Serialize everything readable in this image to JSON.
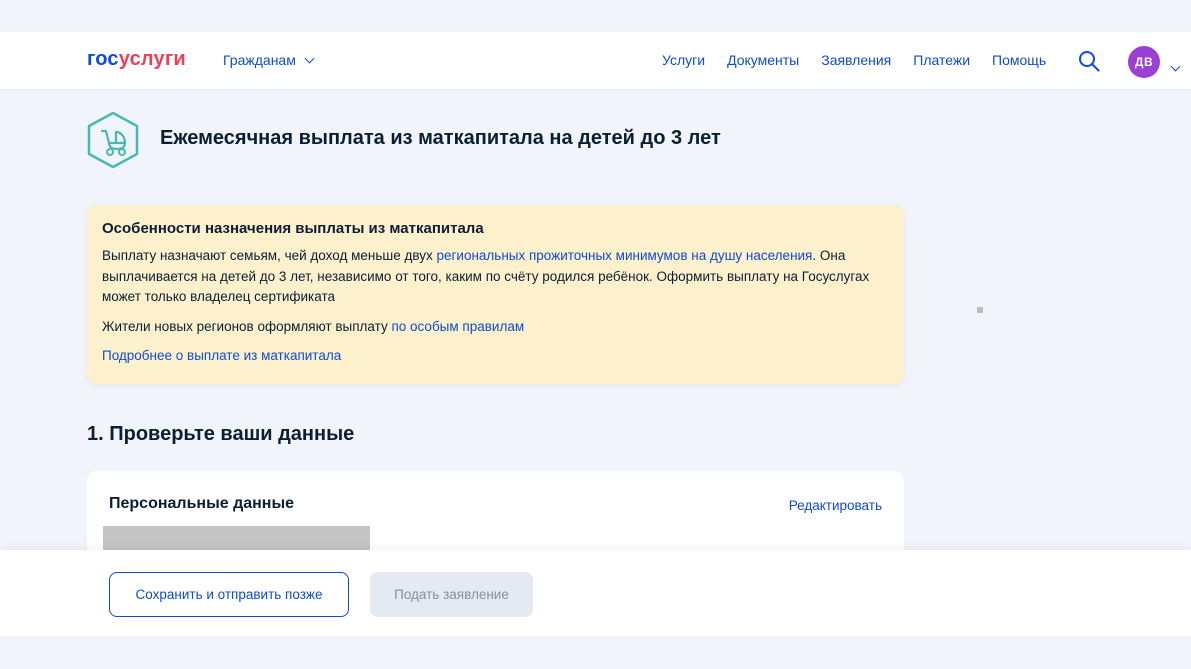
{
  "header": {
    "logo_part1": "гос",
    "logo_part2": "услуги",
    "audience": "Гражданам",
    "nav": [
      "Услуги",
      "Документы",
      "Заявления",
      "Платежи",
      "Помощь"
    ],
    "avatar_initials": "ДВ",
    "icons": {
      "search": "search-icon",
      "chevron": "chevron-down-icon"
    }
  },
  "page": {
    "title": "Ежемесячная выплата из маткапитала на детей до 3 лет",
    "title_icon": "stroller-icon"
  },
  "notice": {
    "heading": "Особенности назначения выплаты из маткапитала",
    "p1_before": "Выплату назначают семьям, чей доход меньше двух ",
    "p1_link": "региональных прожиточных минимумов на душу населения",
    "p1_after": ". Она выплачивается на детей до 3 лет, независимо от того, каким по счёту родился ребёнок. Оформить выплату на Госуслугах может только владелец сертификата",
    "p2_before": "Жители новых регионов оформляют выплату ",
    "p2_link": "по особым правилам",
    "p3_link": "Подробнее о выплате из маткапитала"
  },
  "step": {
    "title": "1. Проверьте ваши данные"
  },
  "personal_card": {
    "title": "Персональные данные",
    "edit_label": "Редактировать"
  },
  "footer": {
    "save_later": "Сохранить и отправить позже",
    "submit": "Подать заявление"
  },
  "colors": {
    "accent": "#0d4cd3",
    "brand_red": "#ee3f58",
    "notice_bg": "#fdf0cc",
    "avatar_bg": "#9b3fd5",
    "icon_teal": "#46b9b1"
  }
}
